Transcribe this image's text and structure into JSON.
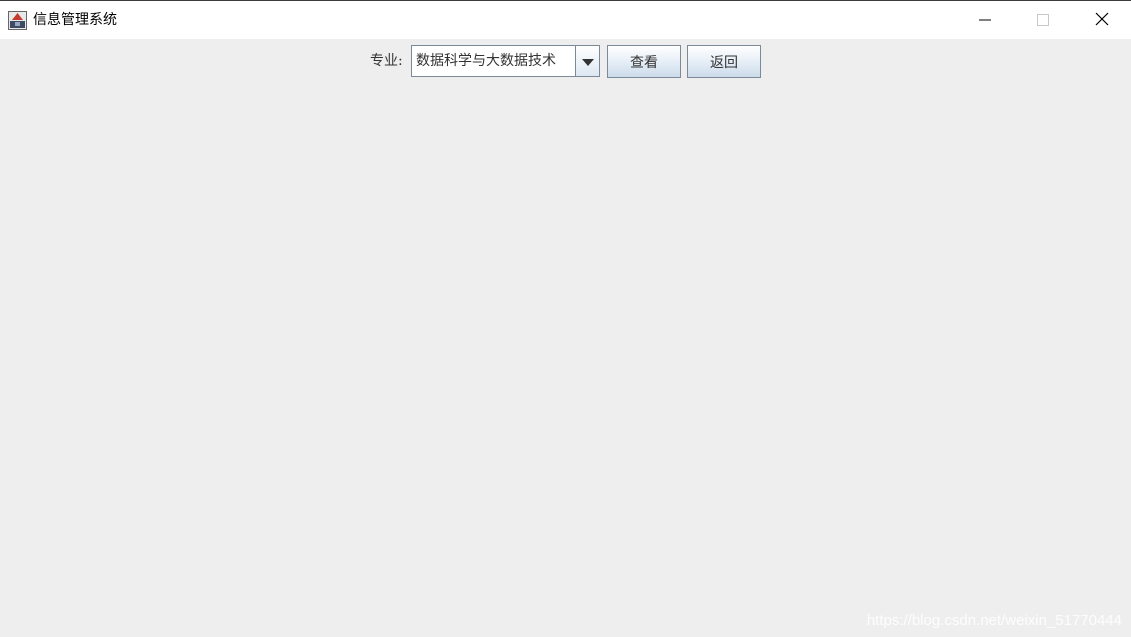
{
  "window": {
    "title": "信息管理系统",
    "controls": {
      "minimize_icon": "minimize-icon",
      "maximize_icon": "maximize-icon",
      "close_icon": "close-icon"
    }
  },
  "form": {
    "major_label": "专业:",
    "major_select": {
      "selected": "数据科学与大数据技术"
    },
    "view_button": "查看",
    "back_button": "返回"
  },
  "watermark": "https://blog.csdn.net/weixin_51770444",
  "colors": {
    "title_bar": "#ffffff",
    "background": "#eeeeee",
    "button_border": "#7a8a99",
    "text": "#333333"
  }
}
